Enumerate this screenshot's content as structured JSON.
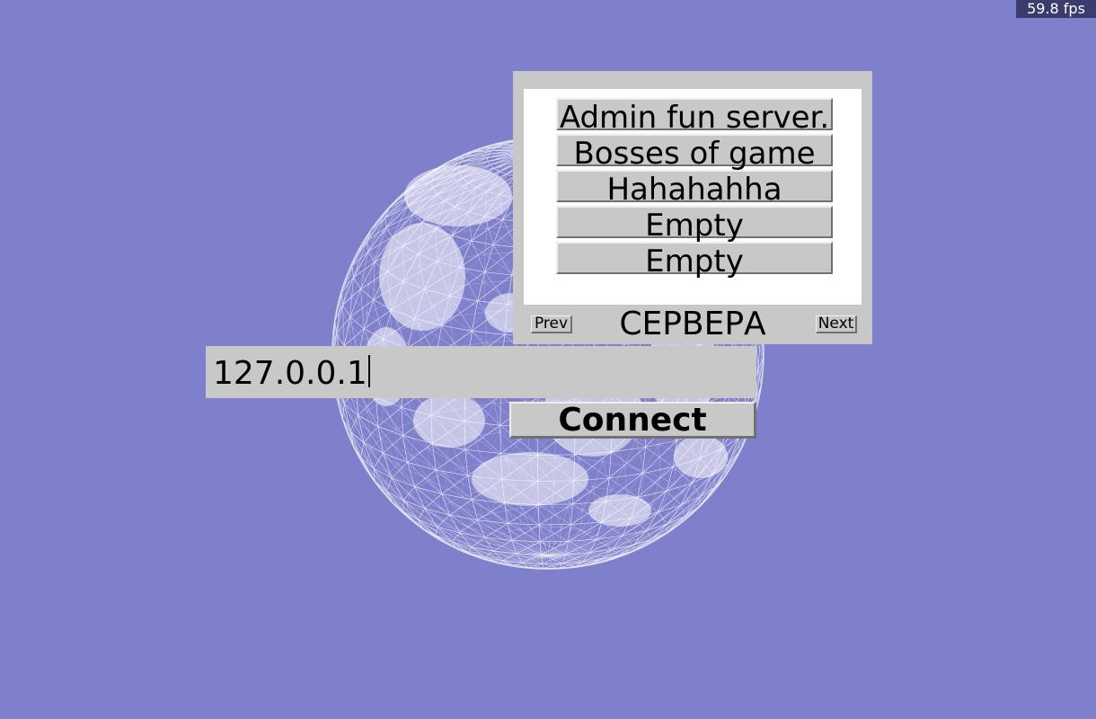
{
  "hud": {
    "fps_text": "59.8 fps"
  },
  "server_browser": {
    "title": "СЕРВЕРА",
    "prev_label": "Prev",
    "next_label": "Next",
    "servers": [
      {
        "name": "Admin fun server."
      },
      {
        "name": "Bosses of game"
      },
      {
        "name": "Hahahahha"
      },
      {
        "name": "Empty"
      },
      {
        "name": "Empty"
      }
    ]
  },
  "connect_form": {
    "address_value": "127.0.0.1",
    "connect_label": "Connect"
  },
  "background": {
    "scene": "wireframe-globe",
    "sky_color": "#7f80cb",
    "wire_color": "#ffffff"
  },
  "colors": {
    "widget_gray": "#c8c8c8",
    "list_background": "#ffffff",
    "fps_background": "#3b3b6e"
  }
}
